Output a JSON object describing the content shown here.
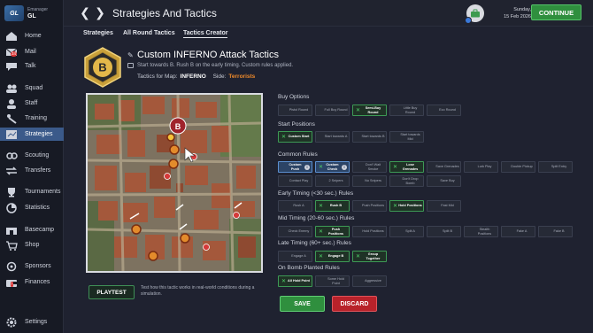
{
  "brand": {
    "line1": "Emanager",
    "line2": "GL",
    "logo_text": "GL"
  },
  "sidebar": {
    "items": [
      {
        "label": "Home",
        "icon": "home-icon"
      },
      {
        "label": "Mail",
        "icon": "mail-icon",
        "badge": "34"
      },
      {
        "label": "Talk",
        "icon": "talk-icon"
      },
      {
        "label": "Squad",
        "icon": "squad-icon"
      },
      {
        "label": "Staff",
        "icon": "staff-icon"
      },
      {
        "label": "Training",
        "icon": "training-icon"
      },
      {
        "label": "Strategies",
        "icon": "strategies-icon",
        "active": true
      },
      {
        "label": "Scouting",
        "icon": "scouting-icon"
      },
      {
        "label": "Transfers",
        "icon": "transfers-icon"
      },
      {
        "label": "Tournaments",
        "icon": "trophy-icon"
      },
      {
        "label": "Statistics",
        "icon": "statistics-icon"
      },
      {
        "label": "Basecamp",
        "icon": "basecamp-icon"
      },
      {
        "label": "Shop",
        "icon": "shop-icon"
      },
      {
        "label": "Sponsors",
        "icon": "sponsors-icon"
      },
      {
        "label": "Finances",
        "icon": "finances-icon",
        "badge": "!"
      },
      {
        "label": "Settings",
        "icon": "gear-icon"
      }
    ]
  },
  "topbar": {
    "title": "Strategies And Tactics",
    "date_day": "Sunday,",
    "date_full": "15 Feb 2026",
    "continue_label": "CONTINUE"
  },
  "tabs": [
    {
      "label": "Strategies"
    },
    {
      "label": "All Round Tactics"
    },
    {
      "label": "Tactics Creator",
      "active": true
    }
  ],
  "tactic": {
    "badge_letter": "B",
    "title": "Custom INFERNO Attack Tactics",
    "description": "Start towards B. Rush B on the early timing. Custom rules applied.",
    "map_label": "Tactics for Map:",
    "map_value": "INFERNO",
    "side_label": "Side:",
    "side_value": "Terrorists"
  },
  "map": {
    "marker_label": "B"
  },
  "playtest": {
    "label": "PLAYTEST",
    "description": "Test how this tactic works in real-world conditions during a simulation."
  },
  "sections": {
    "buy": {
      "title": "Buy Options",
      "options": [
        {
          "label": "Pistol Round",
          "selected": false
        },
        {
          "label": "Full Buy Round",
          "selected": false
        },
        {
          "label": "Semi-Buy Round",
          "selected": true
        },
        {
          "label": "Little Buy Round",
          "selected": false
        },
        {
          "label": "Eco Round",
          "selected": false
        }
      ]
    },
    "start": {
      "title": "Start Positions",
      "options": [
        {
          "label": "Custom Start",
          "selected": true
        },
        {
          "label": "Start towards A",
          "selected": false
        },
        {
          "label": "Start towards B",
          "selected": false
        },
        {
          "label": "Start towards Mid",
          "selected": false
        }
      ]
    },
    "common": {
      "title": "Common Rules",
      "row1": [
        {
          "label": "Custom Push",
          "selected": false,
          "blue": true,
          "info": "i"
        },
        {
          "label": "Custom Check",
          "selected": true,
          "blue": true,
          "info": "i"
        },
        {
          "label": "Don't Wait Smoke",
          "selected": false
        },
        {
          "label": "Lose Grenades",
          "selected": true
        },
        {
          "label": "Save Grenades",
          "selected": false
        },
        {
          "label": "Lurk Play",
          "selected": false
        },
        {
          "label": "Double Pickup",
          "selected": false
        },
        {
          "label": "Split Entry",
          "selected": false
        }
      ],
      "row2": [
        {
          "label": "Contact Play",
          "selected": false
        },
        {
          "label": "2 Snipers",
          "selected": false
        },
        {
          "label": "No Snipers",
          "selected": false
        },
        {
          "label": "Don't Drop Bomb",
          "selected": false
        },
        {
          "label": "Save Buy",
          "selected": false
        }
      ]
    },
    "early": {
      "title": "Early Timing (<30 sec.) Rules",
      "options": [
        {
          "label": "Rush A",
          "selected": false
        },
        {
          "label": "Rush B",
          "selected": true
        },
        {
          "label": "Push Positions",
          "selected": false
        },
        {
          "label": "Hold Positions",
          "selected": true
        },
        {
          "label": "Fast Mid",
          "selected": false
        }
      ]
    },
    "mid": {
      "title": "Mid Timing (20-60 sec.) Rules",
      "options": [
        {
          "label": "Check Enemy",
          "selected": false
        },
        {
          "label": "Push Positions",
          "selected": true
        },
        {
          "label": "Hold Positions",
          "selected": false
        },
        {
          "label": "Split A",
          "selected": false
        },
        {
          "label": "Split B",
          "selected": false
        },
        {
          "label": "Stealth Positions",
          "selected": false
        },
        {
          "label": "Fake A",
          "selected": false
        },
        {
          "label": "Fake B",
          "selected": false
        }
      ]
    },
    "late": {
      "title": "Late Timing (60+ sec.) Rules",
      "options": [
        {
          "label": "Engage A",
          "selected": false
        },
        {
          "label": "Engage B",
          "selected": true
        },
        {
          "label": "Group Together",
          "selected": true
        }
      ]
    },
    "bomb": {
      "title": "On Bomb Planted Rules",
      "options": [
        {
          "label": "All Hold Point",
          "selected": true
        },
        {
          "label": "Some Hold Point",
          "selected": false
        },
        {
          "label": "Aggressive",
          "selected": false
        }
      ]
    }
  },
  "actions": {
    "save_label": "SAVE",
    "discard_label": "DISCARD"
  },
  "colors": {
    "accent_green": "#2f8f3e",
    "accent_red": "#b8222a",
    "active_nav": "#3b5a8a",
    "side_color": "#f08a2a"
  }
}
